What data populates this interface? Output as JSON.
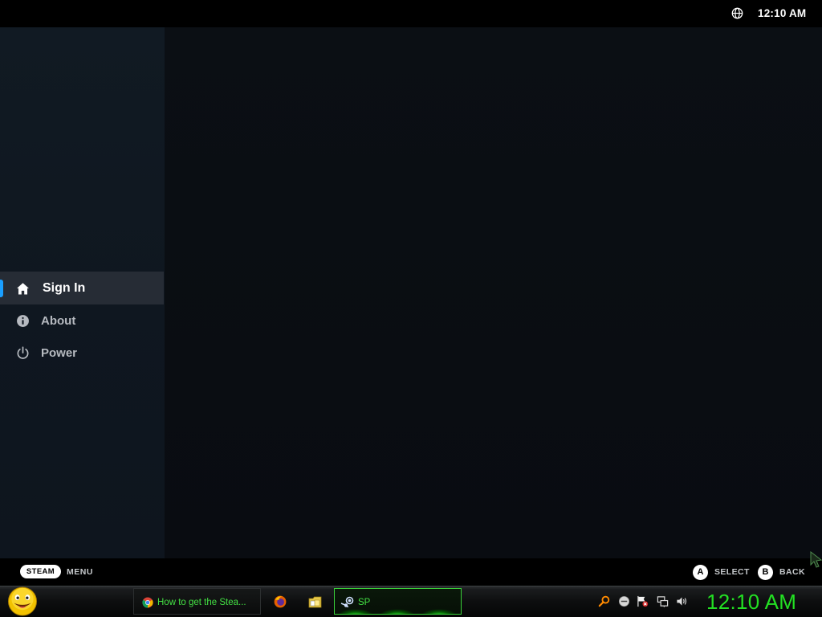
{
  "top_bar": {
    "clock": "12:10 AM",
    "language_icon": "globe-icon"
  },
  "sidebar": {
    "items": [
      {
        "label": "Sign In",
        "icon": "home-icon",
        "selected": true
      },
      {
        "label": "About",
        "icon": "info-icon",
        "selected": false
      },
      {
        "label": "Power",
        "icon": "power-icon",
        "selected": false
      }
    ],
    "accent_color": "#1a9fff"
  },
  "hint_bar": {
    "steam_button": "STEAM",
    "menu_label": "MENU",
    "a_button": "A",
    "select_label": "SELECT",
    "b_button": "B",
    "back_label": "BACK"
  },
  "taskbar": {
    "start_button_icon": "smiley-start-icon",
    "tasks": [
      {
        "label": "How to get the Stea...",
        "icon": "chrome-icon"
      },
      {
        "label": "",
        "icon": "firefox-icon"
      },
      {
        "label": "",
        "icon": "folder-icon"
      },
      {
        "label": "SP",
        "icon": "steam-icon",
        "active": true
      }
    ],
    "tray_icons": [
      "search-icon",
      "ime-icon",
      "flag-icon",
      "network-icon",
      "volume-icon"
    ],
    "clock": "12:10 AM",
    "clock_color": "#23e023"
  }
}
